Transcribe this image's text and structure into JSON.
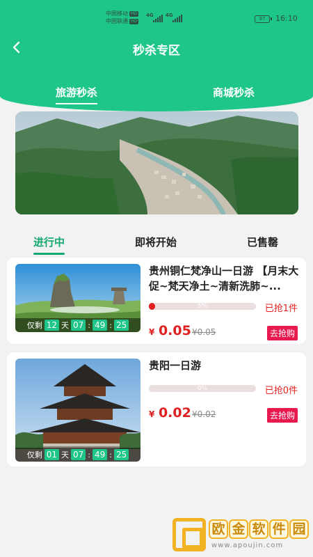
{
  "status_bar": {
    "carrier1": "中国移动",
    "carrier2": "中国联通",
    "hd": "HD",
    "net1": "4G",
    "net2": "4G",
    "battery": "97",
    "time": "16:10"
  },
  "header": {
    "title": "秒杀专区",
    "tabs": [
      {
        "label": "旅游秒杀",
        "active": true
      },
      {
        "label": "商城秒杀",
        "active": false
      }
    ]
  },
  "sub_tabs": [
    {
      "label": "进行中",
      "active": true
    },
    {
      "label": "即将开始",
      "active": false
    },
    {
      "label": "已售罄",
      "active": false
    }
  ],
  "products": [
    {
      "name": "贵州铜仁梵净山一日游 【月末大促~梵天净土~清新洗肺~...",
      "remaining_prefix": "仅剩",
      "days": "12",
      "day_unit": "天",
      "hours": "07",
      "minutes": "49",
      "seconds": "25",
      "percent_label": "5%",
      "percent": 5,
      "sold": "已抢1件",
      "currency": "¥",
      "price": "0.05",
      "original_price": "¥0.05",
      "buy_label": "去抢购"
    },
    {
      "name": "贵阳一日游",
      "remaining_prefix": "仅剩",
      "days": "01",
      "day_unit": "天",
      "hours": "07",
      "minutes": "49",
      "seconds": "25",
      "percent_label": "0%",
      "percent": 0,
      "sold": "已抢0件",
      "currency": "¥",
      "price": "0.02",
      "original_price": "¥0.02",
      "buy_label": "去抢购"
    }
  ],
  "watermark": {
    "chars": [
      "欧",
      "金",
      "软",
      "件",
      "园"
    ],
    "url": "www.apoujin.com"
  },
  "colors": {
    "brand": "#1ec689",
    "accent_text": "#12a86f",
    "price": "#e02020",
    "buy_button": "#e8194f"
  },
  "icons": {
    "back": "chevron-left-icon"
  }
}
